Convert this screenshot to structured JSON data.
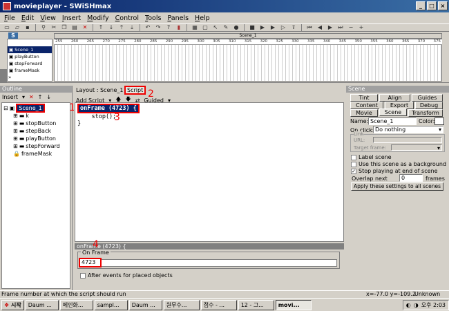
{
  "window": {
    "title": "movieplayer - SWiSHmax"
  },
  "menu": [
    "File",
    "Edit",
    "View",
    "Insert",
    "Modify",
    "Control",
    "Tools",
    "Panels",
    "Help"
  ],
  "timeline": {
    "scene_label": "Scene_1",
    "rows": [
      "Scene_1",
      "playButton",
      "stepForward",
      "frameMask"
    ],
    "ruler": [
      "255",
      "260",
      "265",
      "270",
      "275",
      "280",
      "285",
      "290",
      "295",
      "300",
      "305",
      "310",
      "315",
      "320",
      "325",
      "330",
      "335",
      "340",
      "345",
      "350",
      "355",
      "360",
      "365",
      "370",
      "375"
    ]
  },
  "outline": {
    "title": "Outline",
    "insert_label": "Insert",
    "items": [
      "Scene_1",
      "k",
      "stopButton",
      "stepBack",
      "playButton",
      "stepForward",
      "frameMask"
    ]
  },
  "script": {
    "layout_label": "Layout : Scene_1",
    "tab_script": "Script",
    "add_script": "Add Script",
    "guided": "Guided",
    "lines": [
      "onFrame (4723) {",
      "    stop();",
      "}"
    ],
    "footer_head": "onFrame (4723) {",
    "on_frame_label": "On Frame",
    "frame_value": "4723",
    "after_events": "After events for placed objects"
  },
  "scene_panel": {
    "title": "Scene",
    "tabs": [
      "Tint",
      "Align",
      "Guides",
      "Content",
      "Export",
      "Debug",
      "Movie",
      "Scene",
      "Transform"
    ],
    "name_label": "Name:",
    "name_value": "Scene_1",
    "color_label": "Color:",
    "onclick_label": "On click:",
    "onclick_value": "Do nothing",
    "link_label": "Link",
    "url_label": "URL:",
    "target_label": "Target frame:",
    "label_scene": "Label scene",
    "use_bg": "Use this scene as a background",
    "stop_playing": "Stop playing at end of scene",
    "overlap_label": "Overlap next",
    "overlap_value": "0",
    "frames_label": "frames",
    "apply_btn": "Apply these settings to all scenes"
  },
  "status": {
    "text": "Frame number at which the script should run",
    "coords": "x=-77.0 y=-109.2",
    "size": "Unknown Size"
  },
  "annotations": [
    "1",
    "2",
    "3",
    "4"
  ],
  "taskbar": {
    "start": "시작",
    "items": [
      "Daum ...",
      "메인화...",
      "sampl...",
      "Daum ...",
      "원무수...",
      "접수 - ...",
      "12 - 그...",
      "movi..."
    ],
    "clock": "오후 2:03"
  }
}
